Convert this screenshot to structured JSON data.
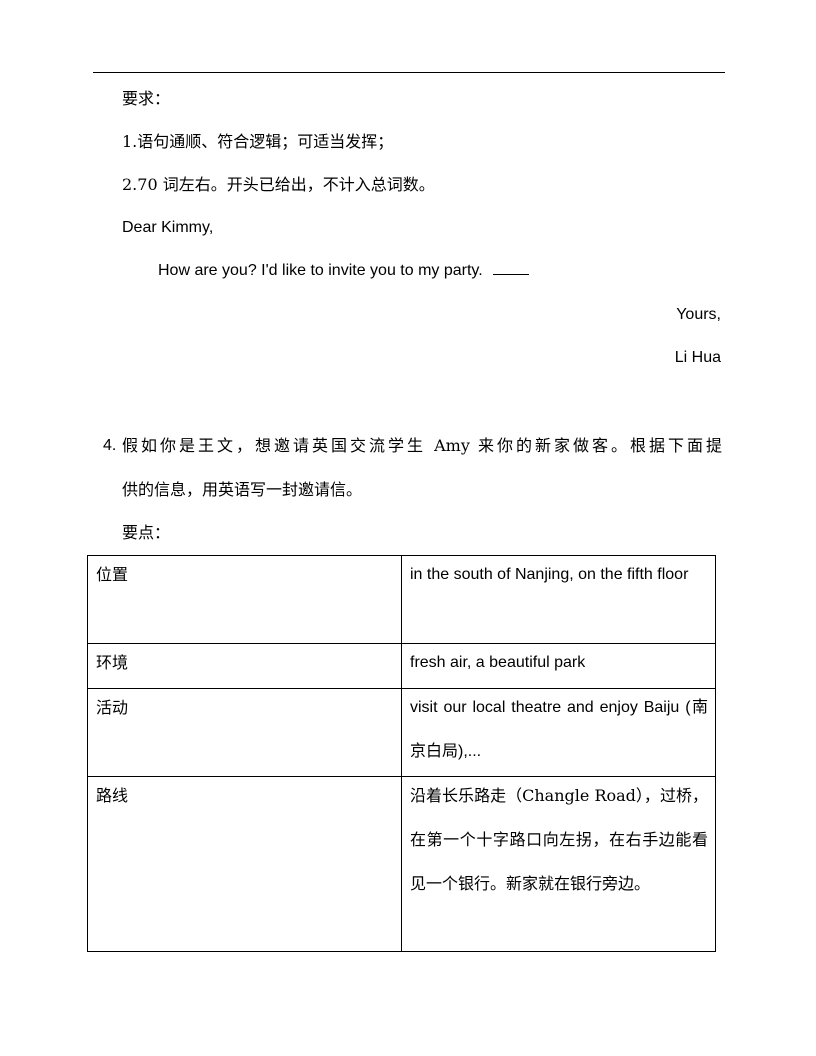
{
  "requirements": {
    "title": "要求：",
    "items": [
      "1.语句通顺、符合逻辑；可适当发挥；",
      "2.70  词左右。开头已给出，不计入总词数。"
    ]
  },
  "letter": {
    "salutation": "Dear Kimmy,",
    "opening": "How are you? I'd like to invite you to my party.",
    "closing": "Yours,",
    "signature": "Li Hua"
  },
  "question": {
    "number": "4.",
    "prompt_line1": "假如你是王文，想邀请英国交流学生 Amy 来你的新家做客。根据下面提",
    "prompt_line2": "供的信息，用英语写一封邀请信。",
    "points_label": "要点："
  },
  "table": {
    "rows": [
      {
        "label": "位置",
        "value": "in the south of Nanjing, on the fifth floor"
      },
      {
        "label": "环境",
        "value": "fresh air, a beautiful park"
      },
      {
        "label": "活动",
        "value": "visit our local theatre and enjoy Baiju (南京白局),..."
      },
      {
        "label": "路线",
        "value": "沿着长乐路走（Changle Road），过桥，在第一个十字路口向左拐，在右手边能看见一个银行。新家就在银行旁边。"
      }
    ]
  }
}
